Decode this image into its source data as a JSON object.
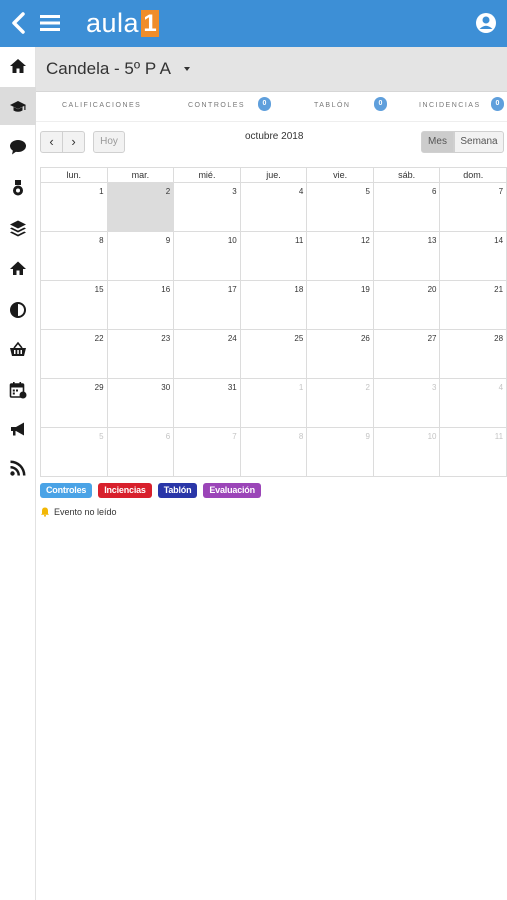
{
  "header": {
    "logo_word": "aula",
    "logo_num": "1"
  },
  "student": {
    "name": "Candela - 5º P A"
  },
  "tabs": [
    {
      "label": "CALIFICACIONES"
    },
    {
      "label": "CONTROLES",
      "badge": "0"
    },
    {
      "label": "TABLÓN",
      "badge": "0"
    },
    {
      "label": "INCIDENCIAS",
      "badge": "0"
    }
  ],
  "calendar": {
    "title": "octubre 2018",
    "prev_label": "‹",
    "next_label": "›",
    "today_label": "Hoy",
    "month_label": "Mes",
    "week_label": "Semana",
    "weekdays": [
      "lun.",
      "mar.",
      "mié.",
      "jue.",
      "vie.",
      "sáb.",
      "dom."
    ],
    "weeks": [
      [
        "1",
        "2",
        "3",
        "4",
        "5",
        "6",
        "7"
      ],
      [
        "8",
        "9",
        "10",
        "11",
        "12",
        "13",
        "14"
      ],
      [
        "15",
        "16",
        "17",
        "18",
        "19",
        "20",
        "21"
      ],
      [
        "22",
        "23",
        "24",
        "25",
        "26",
        "27",
        "28"
      ],
      [
        "29",
        "30",
        "31",
        "1",
        "2",
        "3",
        "4"
      ],
      [
        "5",
        "6",
        "7",
        "8",
        "9",
        "10",
        "11"
      ]
    ]
  },
  "legend": [
    {
      "label": "Controles",
      "color": "#4aa3e6"
    },
    {
      "label": "Inciencias",
      "color": "#d8202c"
    },
    {
      "label": "Tablón",
      "color": "#2a36a8"
    },
    {
      "label": "Evaluación",
      "color": "#9b45b8"
    }
  ],
  "unread_label": "Evento no leído",
  "colors": {
    "topbar": "#3d8fd6",
    "logo_accent": "#f08d2a",
    "badge": "#5f9fdc"
  },
  "sidebar_icons": [
    "home-icon",
    "graduation-cap-icon",
    "chat-bubble-icon",
    "medal-icon",
    "layers-icon",
    "house-icon",
    "clock-icon",
    "basket-icon",
    "calendar-icon",
    "megaphone-icon",
    "rss-icon"
  ]
}
